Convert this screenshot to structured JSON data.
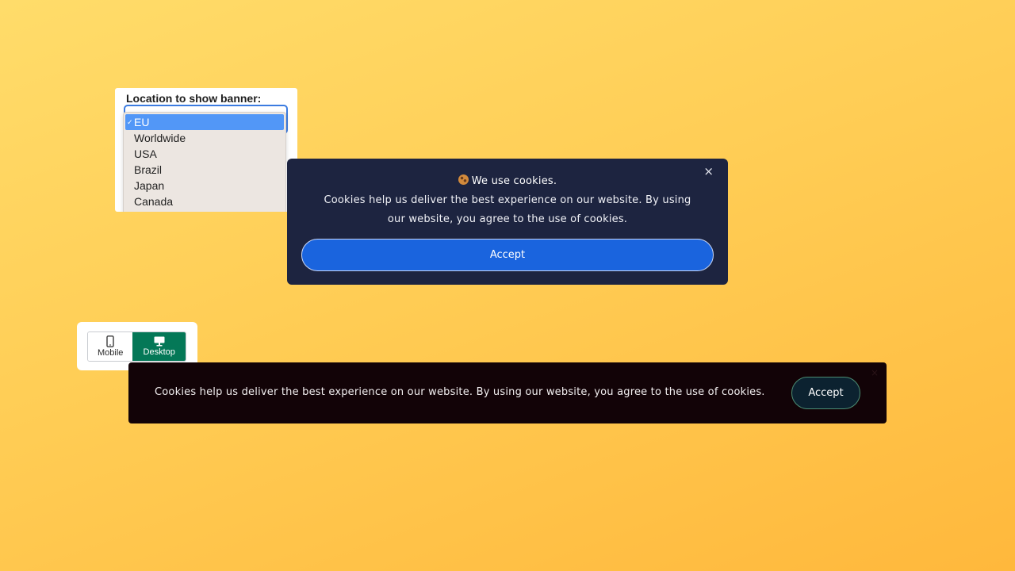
{
  "location_select": {
    "label": "Location to show banner:",
    "selected": "EU",
    "check_glyph": "✓",
    "options": [
      "EU",
      "Worldwide",
      "USA",
      "Brazil",
      "Japan",
      "Canada"
    ]
  },
  "modal_banner": {
    "icon": "cookie-icon",
    "title": "We use cookies.",
    "message": "Cookies help us deliver the best experience on our website. By using our website, you agree to the use of cookies.",
    "accept_label": "Accept",
    "close_glyph": "×",
    "colors": {
      "background": "#1d2440",
      "button": "#1a64de"
    }
  },
  "device_toggle": {
    "options": [
      {
        "label": "Mobile",
        "icon": "mobile-phone-icon",
        "active": false
      },
      {
        "label": "Desktop",
        "icon": "desktop-monitor-icon",
        "active": true
      }
    ],
    "active_color": "#047857"
  },
  "bar_banner": {
    "message": "Cookies help us deliver the best experience on our website. By using our website, you agree to the use of cookies.",
    "accept_label": "Accept",
    "close_glyph": "×",
    "colors": {
      "background": "#120307",
      "button": "#0c2230",
      "button_border": "#4c8d73"
    }
  }
}
